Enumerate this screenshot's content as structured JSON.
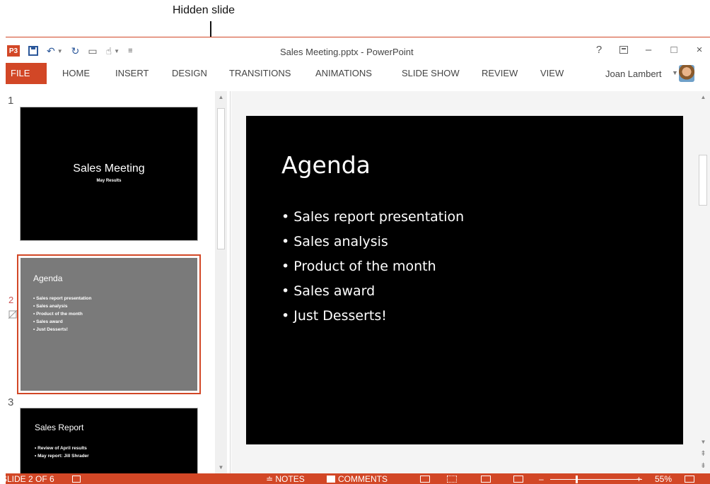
{
  "callout": {
    "label": "Hidden slide"
  },
  "window": {
    "title": "Sales Meeting.pptx - PowerPoint"
  },
  "qat": {
    "app_logo": "P3"
  },
  "window_controls": {
    "help": "?",
    "minimize": "–",
    "maximize": "□",
    "close": "×"
  },
  "ribbon": {
    "tabs": [
      {
        "label": "FILE"
      },
      {
        "label": "HOME"
      },
      {
        "label": "INSERT"
      },
      {
        "label": "DESIGN"
      },
      {
        "label": "TRANSITIONS"
      },
      {
        "label": "ANIMATIONS"
      },
      {
        "label": "SLIDE SHOW"
      },
      {
        "label": "REVIEW"
      },
      {
        "label": "VIEW"
      }
    ],
    "user_name": "Joan Lambert"
  },
  "thumbnails": [
    {
      "number": "1",
      "title": "Sales Meeting",
      "subtitle": "May Results",
      "bullets": []
    },
    {
      "number": "2",
      "title": "Agenda",
      "bullets": [
        "• Sales report presentation",
        "• Sales analysis",
        "• Product of the month",
        "• Sales award",
        "• Just Desserts!"
      ],
      "hidden": true
    },
    {
      "number": "3",
      "title": "Sales Report",
      "bullets": [
        "• Review of April results",
        "• May report: Jill Shrader"
      ]
    }
  ],
  "main_slide": {
    "title": "Agenda",
    "bullets": [
      "• Sales report presentation",
      "• Sales analysis",
      "• Product of the month",
      "• Sales award",
      "• Just Desserts!"
    ]
  },
  "statusbar": {
    "slide_indicator": "SLIDE 2 OF 6",
    "notes": "≐ NOTES",
    "comments": "COMMENTS",
    "zoom": "55%"
  },
  "colors": {
    "accent": "#d24726",
    "slide_bg": "#000000",
    "hidden_thumb_bg": "#7a7a7a"
  }
}
